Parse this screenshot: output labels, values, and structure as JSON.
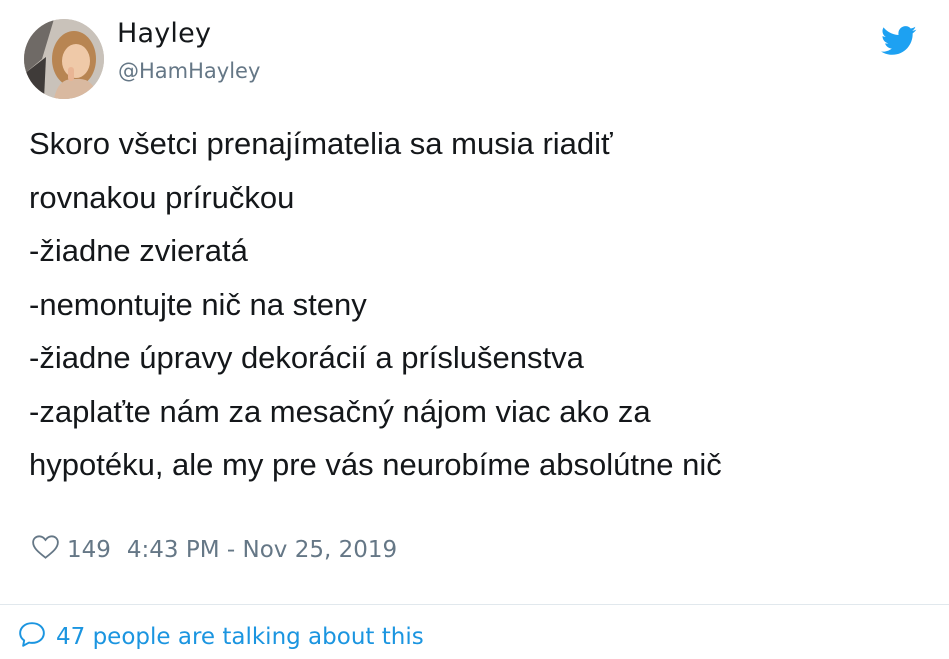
{
  "tweet": {
    "display_name": "Hayley",
    "handle": "@HamHayley",
    "lines": [
      "Skoro všetci prenajímatelia sa musia riadiť",
      "rovnakou príručkou",
      "-žiadne zvieratá",
      "-nemontujte nič na steny",
      "-žiadne úpravy dekorácií a príslušenstva",
      "-zaplaťte nám za mesačný nájom viac ako za",
      "hypotéku, ale my pre vás neurobíme absolútne nič"
    ],
    "like_count": "149",
    "timestamp": "4:43 PM - Nov 25, 2019",
    "talking_text": "47 people are talking about this"
  },
  "icons": {
    "brand": "twitter-bird-icon",
    "like": "heart-icon",
    "reply": "speech-bubble-icon"
  },
  "colors": {
    "brand_blue": "#1da1f2",
    "link_blue": "#1b95e0",
    "secondary_text": "#657786",
    "primary_text": "#14171a"
  }
}
